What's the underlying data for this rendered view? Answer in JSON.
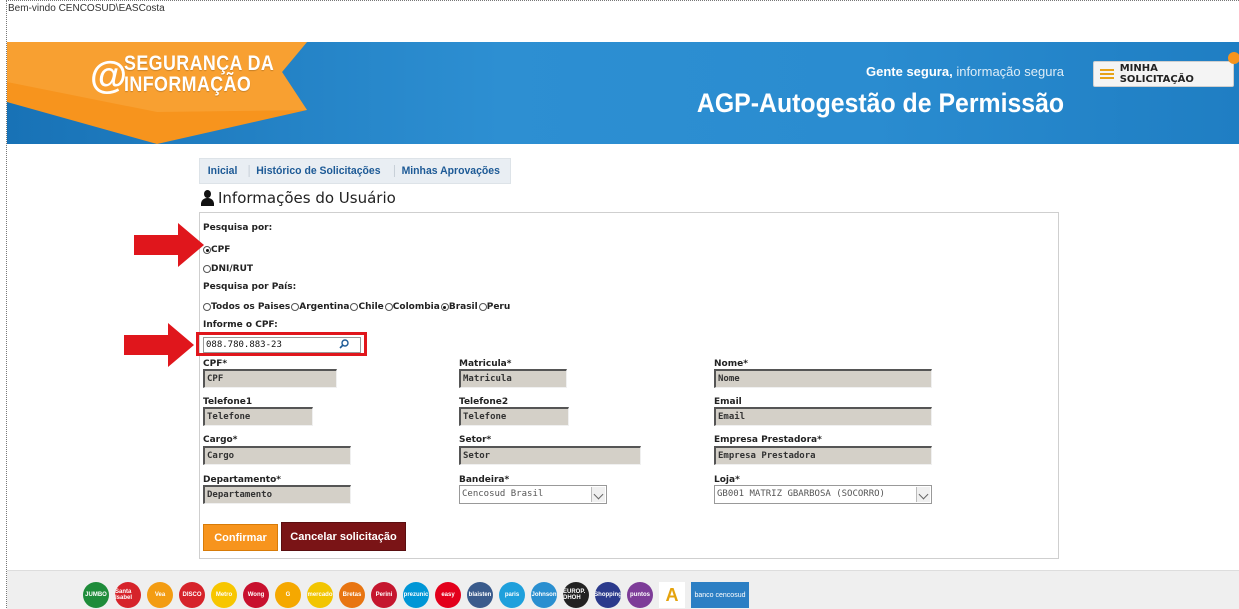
{
  "welcome": "Bem-vindo CENCOSUD\\EASCosta",
  "banner": {
    "logo_line1": "SEGURANÇA DA",
    "logo_line2": "INFORMAÇÃO",
    "logo_symbol": "@",
    "tagline_bold": "Gente segura,",
    "tagline_rest": "informação segura",
    "app_title": "AGP-Autogestão de Permissão",
    "minha_solicitacao": "MINHA SOLICITAÇÃO"
  },
  "tabs": [
    "Inicial",
    "Histórico de Solicitações",
    "Minhas Aprovações"
  ],
  "section_title": "Informações do Usuário",
  "search": {
    "pesquisa_por_label": "Pesquisa por:",
    "option_cpf": "CPF",
    "option_dni": "DNI/RUT",
    "selected": "CPF",
    "pais_label": "Pesquisa por País:",
    "countries": [
      "Todos os Paises",
      "Argentina",
      "Chile",
      "Colombia",
      "Brasil",
      "Peru"
    ],
    "selected_country": "Brasil",
    "informe_label": "Informe o CPF:",
    "cpf_value": "088.780.883-23"
  },
  "fields": {
    "cpf": {
      "label": "CPF*",
      "value": "CPF"
    },
    "matricula": {
      "label": "Matricula*",
      "value": "Matricula"
    },
    "nome": {
      "label": "Nome*",
      "value": "Nome"
    },
    "telefone1": {
      "label": "Telefone1",
      "value": "Telefone"
    },
    "telefone2": {
      "label": "Telefone2",
      "value": "Telefone"
    },
    "email": {
      "label": "Email",
      "value": "Email"
    },
    "cargo": {
      "label": "Cargo*",
      "value": "Cargo"
    },
    "setor": {
      "label": "Setor*",
      "value": "Setor"
    },
    "empresa": {
      "label": "Empresa Prestadora*",
      "value": "Empresa Prestadora"
    },
    "departamento": {
      "label": "Departamento*",
      "value": "Departamento"
    },
    "bandeira": {
      "label": "Bandeira*",
      "value": "Cencosud Brasil"
    },
    "loja": {
      "label": "Loja*",
      "value": "GB001 MATRIZ GBARBOSA (SOCORRO)"
    }
  },
  "buttons": {
    "confirm": "Confirmar",
    "cancel": "Cancelar solicitação"
  },
  "brands": [
    {
      "name": "JUMBO",
      "color": "#1e8c3a"
    },
    {
      "name": "Santa Isabel",
      "color": "#d6232a"
    },
    {
      "name": "Vea",
      "color": "#f39c12"
    },
    {
      "name": "DISCO",
      "color": "#d6232a"
    },
    {
      "name": "Metro",
      "color": "#f7c600"
    },
    {
      "name": "Wong",
      "color": "#c8102e"
    },
    {
      "name": "G",
      "color": "#f5a800"
    },
    {
      "name": "mercado",
      "color": "#f2c500"
    },
    {
      "name": "Bretas",
      "color": "#e87511"
    },
    {
      "name": "Perini",
      "color": "#c5162e"
    },
    {
      "name": "prezunic",
      "color": "#0096d6"
    },
    {
      "name": "easy",
      "color": "#e3001b"
    },
    {
      "name": "blaisten",
      "color": "#3a5b8c"
    },
    {
      "name": "paris",
      "color": "#1fa0dc"
    },
    {
      "name": "Johnson",
      "color": "#2a8fd0"
    },
    {
      "name": "EUROP. DHOH",
      "color": "#222222"
    },
    {
      "name": "Shopping",
      "color": "#2b3a8c"
    },
    {
      "name": "puntos",
      "color": "#7d3c98"
    },
    {
      "name": "A",
      "color": "#ffffff"
    }
  ],
  "bank_label": "banco cencosud",
  "colors": {
    "accent": "#f7941d",
    "banner": "#2a8cd0",
    "cancel": "#7a1416",
    "highlight": "#e0161c"
  }
}
